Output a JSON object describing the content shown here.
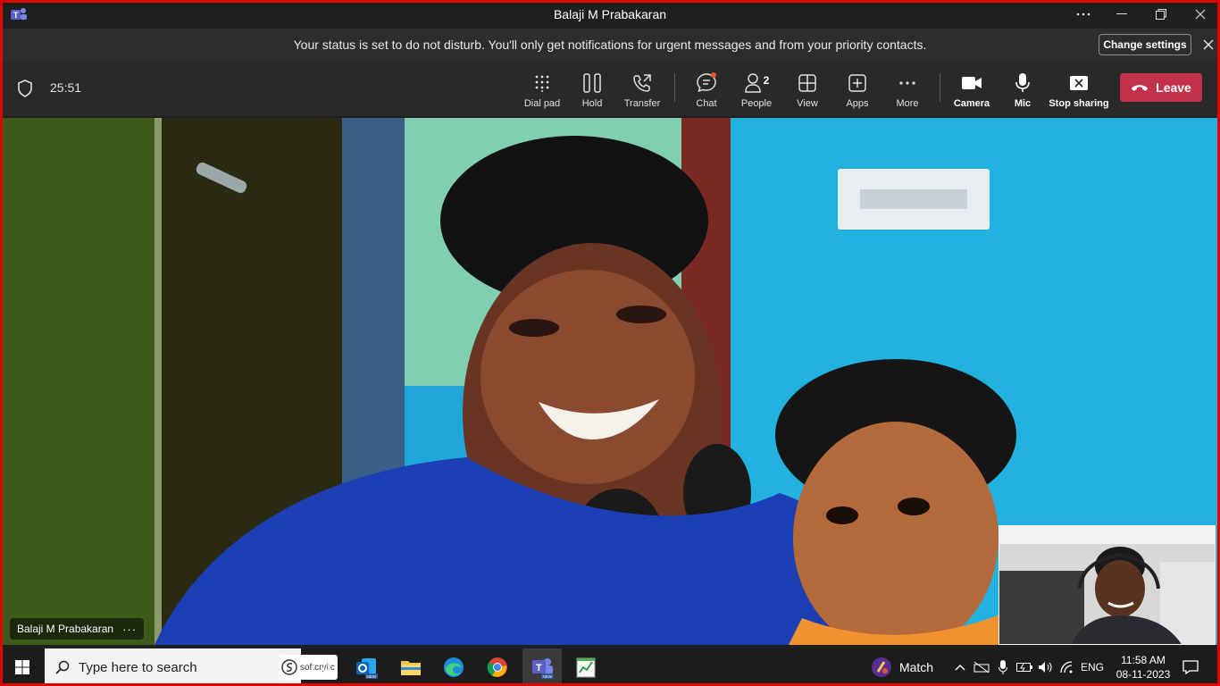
{
  "window": {
    "title": "Balaji M Prabakaran"
  },
  "notification": {
    "text": "Your status is set to do not disturb. You'll only get notifications for urgent messages and from your priority contacts.",
    "button": "Change settings"
  },
  "call": {
    "duration": "25:51",
    "tools": {
      "dialpad": "Dial pad",
      "hold": "Hold",
      "transfer": "Transfer",
      "chat": "Chat",
      "people": "People",
      "people_count": "2",
      "view": "View",
      "apps": "Apps",
      "more": "More",
      "camera": "Camera",
      "mic": "Mic",
      "stop_sharing": "Stop sharing",
      "leave": "Leave"
    },
    "participant_name": "Balaji M Prabakaran",
    "participant_more": "···"
  },
  "taskbar": {
    "search_placeholder": "Type here to search",
    "pinned_brand": "softcrylic",
    "widget_label": "Match",
    "language": "ENG",
    "time": "11:58 AM",
    "date": "08-11-2023"
  },
  "colors": {
    "leave": "#c4314b",
    "frame": "#e00000",
    "chat_badge": "#e8572a",
    "teams": "#6264a7"
  }
}
